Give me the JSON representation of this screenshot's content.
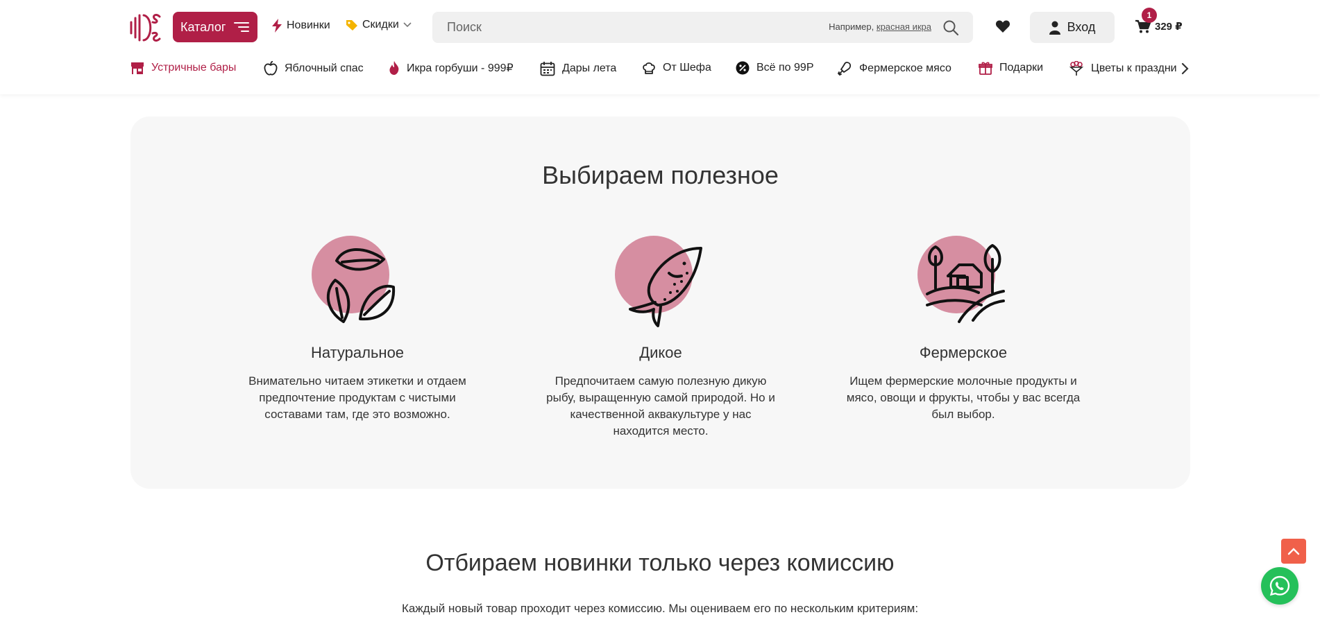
{
  "colors": {
    "brand": "#b01f47",
    "blob": "#d68ea1",
    "card_bg": "#f7f7f7",
    "scroll_top": "#f0604a",
    "whatsapp": "#25c05a"
  },
  "header": {
    "catalog_label": "Каталог",
    "nav": [
      {
        "label": "Новинки",
        "icon": "lightning-icon"
      },
      {
        "label": "Скидки",
        "icon": "price-tag-icon"
      }
    ],
    "search": {
      "placeholder": "Поиск",
      "hint_prefix": "Например,",
      "hint_example": "красная икра"
    },
    "login_label": "Вход",
    "cart": {
      "count": "1",
      "total": "329 ₽"
    }
  },
  "categories": [
    {
      "label": "Устричные бары",
      "icon": "storefront-icon",
      "active": true
    },
    {
      "label": "Яблочный спас",
      "icon": "apple-icon"
    },
    {
      "label": "Икра горбуши - 999₽",
      "icon": "flame-icon"
    },
    {
      "label": "Дары лета",
      "icon": "calendar-icon"
    },
    {
      "label": "От Шефа",
      "icon": "chef-hat-icon"
    },
    {
      "label": "Всё по 99Р",
      "icon": "percent-badge-icon"
    },
    {
      "label": "Фермерское мясо",
      "icon": "meat-leg-icon"
    },
    {
      "label": "Подарки",
      "icon": "gift-icon"
    },
    {
      "label": "Цветы к праздни",
      "icon": "bouquet-icon"
    }
  ],
  "card": {
    "title": "Выбираем полезное",
    "features": [
      {
        "title": "Натуральное",
        "text": "Внимательно читаем этикетки и отдаем предпочтение продуктам с чистыми составами там, где это возможно.",
        "icon": "leaves-icon"
      },
      {
        "title": "Дикое",
        "text": "Предпочитаем самую полезную дикую рыбу, выращенную самой природой. Но и качественной аквакультуре у нас находится место.",
        "icon": "fish-icon"
      },
      {
        "title": "Фермерское",
        "text": "Ищем фермерские молочные продукты и мясо, овощи и фрукты, чтобы у вас всегда был выбор.",
        "icon": "farm-icon"
      }
    ]
  },
  "section": {
    "title": "Отбираем новинки только через комиссию",
    "text": "Каждый новый товар проходит через комиссию. Мы оцениваем его по нескольким критериям:"
  }
}
